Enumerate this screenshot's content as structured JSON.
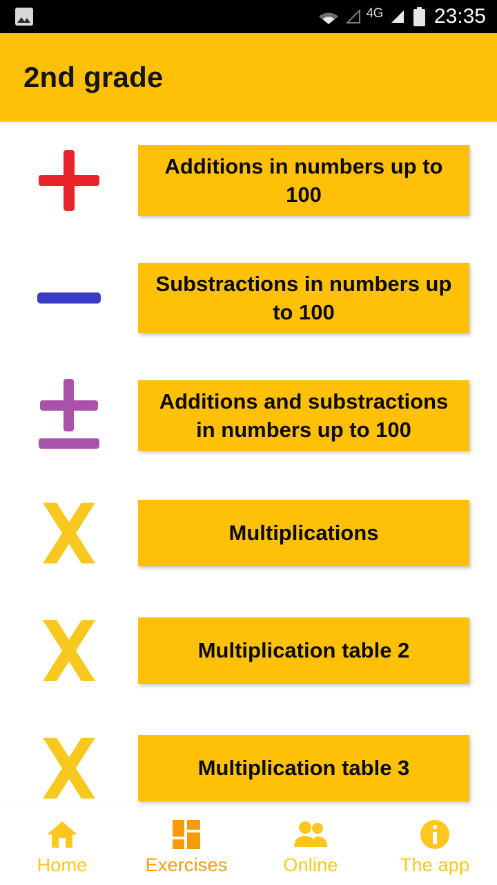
{
  "statusbar": {
    "photo_icon": "image-icon",
    "wifi_icon": "wifi-icon",
    "signal_empty_icon": "signal-empty-icon",
    "network_label": "4G",
    "signal_full_icon": "signal-full-icon",
    "battery_icon": "battery-icon",
    "time": "23:35"
  },
  "appbar": {
    "title": "2nd grade",
    "background_color": "#FFC107"
  },
  "colors": {
    "amber": "#FFC107",
    "plus_red": "#E8232A",
    "minus_blue": "#3B3BC4",
    "plusminus_purple": "#AA52AA",
    "times_yellow": "#F7C91E",
    "nav_yellow": "#FFC61E",
    "nav_active_orange": "#F59B0B"
  },
  "exercises": [
    {
      "icon": "plus-icon",
      "icon_color": "#E8232A",
      "label": "Additions in numbers up to 100"
    },
    {
      "icon": "minus-icon",
      "icon_color": "#3B3BC4",
      "label": "Substractions in numbers up to 100"
    },
    {
      "icon": "plus-minus-icon",
      "icon_color": "#AA52AA",
      "label": "Additions and substractions in numbers up to 100"
    },
    {
      "icon": "times-icon",
      "icon_color": "#F7C91E",
      "label": "Multiplications"
    },
    {
      "icon": "times-icon",
      "icon_color": "#F7C91E",
      "label": "Multiplication table 2"
    },
    {
      "icon": "times-icon",
      "icon_color": "#F7C91E",
      "label": "Multiplication table 3"
    }
  ],
  "bottomnav": {
    "items": [
      {
        "icon": "home-icon",
        "label": "Home",
        "active": false
      },
      {
        "icon": "grid-icon",
        "label": "Exercises",
        "active": true
      },
      {
        "icon": "people-icon",
        "label": "Online",
        "active": false
      },
      {
        "icon": "info-icon",
        "label": "The app",
        "active": false
      }
    ]
  }
}
